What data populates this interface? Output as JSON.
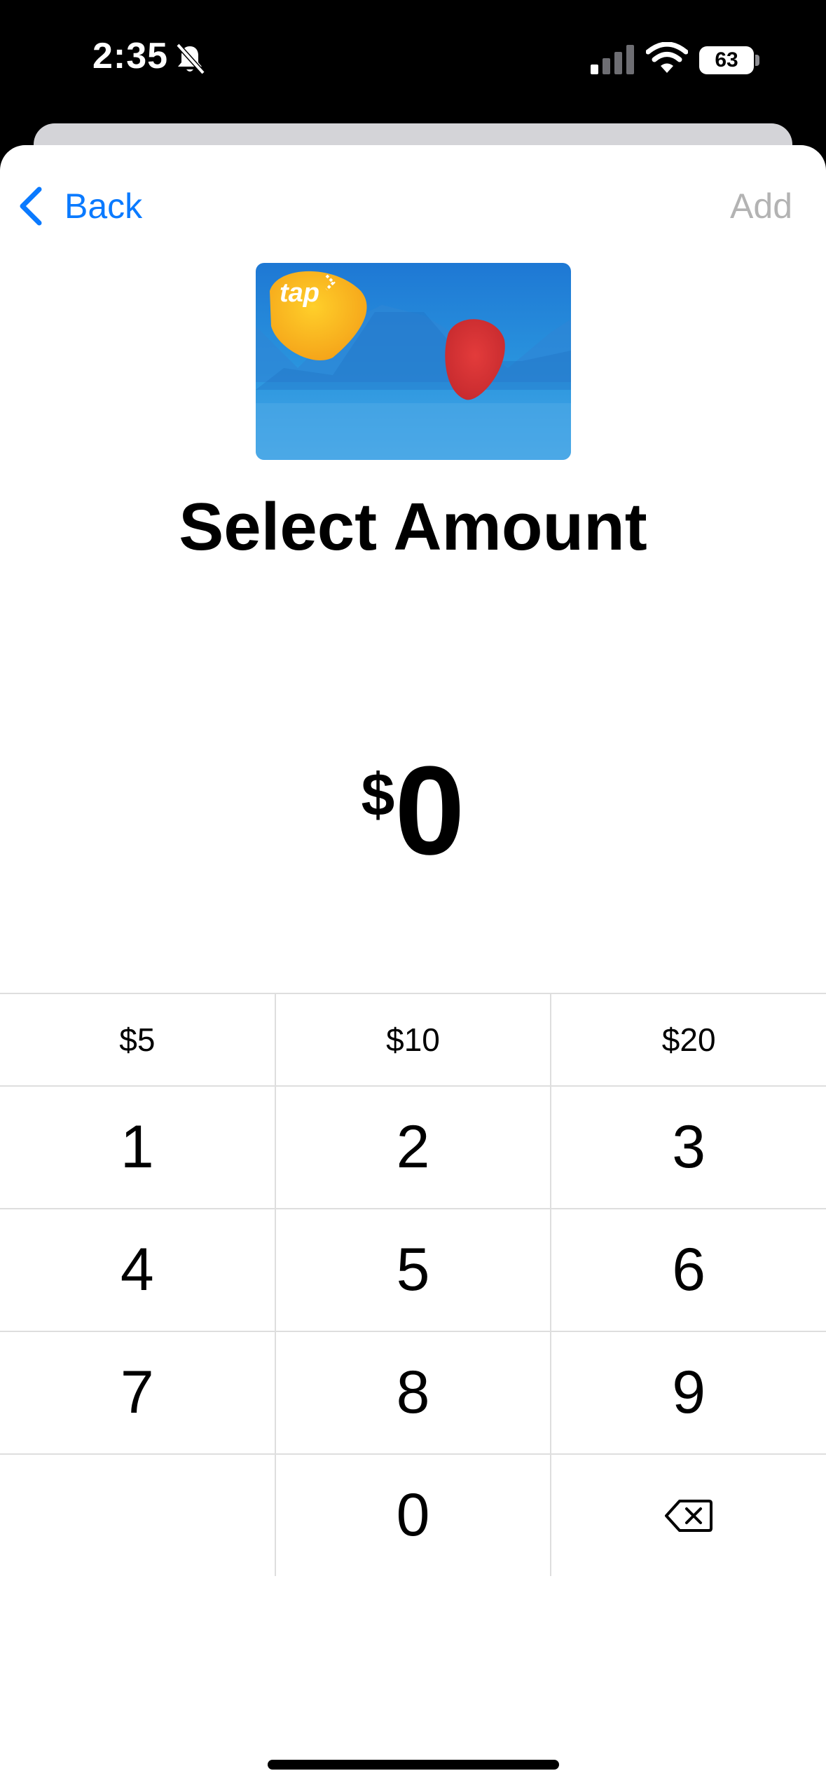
{
  "status_bar": {
    "time": "2:35",
    "battery": "63",
    "icons": [
      "bell-slash-icon",
      "cellular-signal-icon",
      "wifi-icon",
      "battery-icon"
    ]
  },
  "nav": {
    "back_label": "Back",
    "add_label": "Add",
    "accent_color": "#0a7aff",
    "disabled_color": "#b3b3b3"
  },
  "card": {
    "logo_text": "tap"
  },
  "title": "Select Amount",
  "amount": {
    "currency": "$",
    "value": "0"
  },
  "keypad": {
    "presets": [
      "$5",
      "$10",
      "$20"
    ],
    "rows": [
      [
        "1",
        "2",
        "3"
      ],
      [
        "4",
        "5",
        "6"
      ],
      [
        "7",
        "8",
        "9"
      ],
      [
        "",
        "0",
        "delete-icon"
      ]
    ]
  }
}
